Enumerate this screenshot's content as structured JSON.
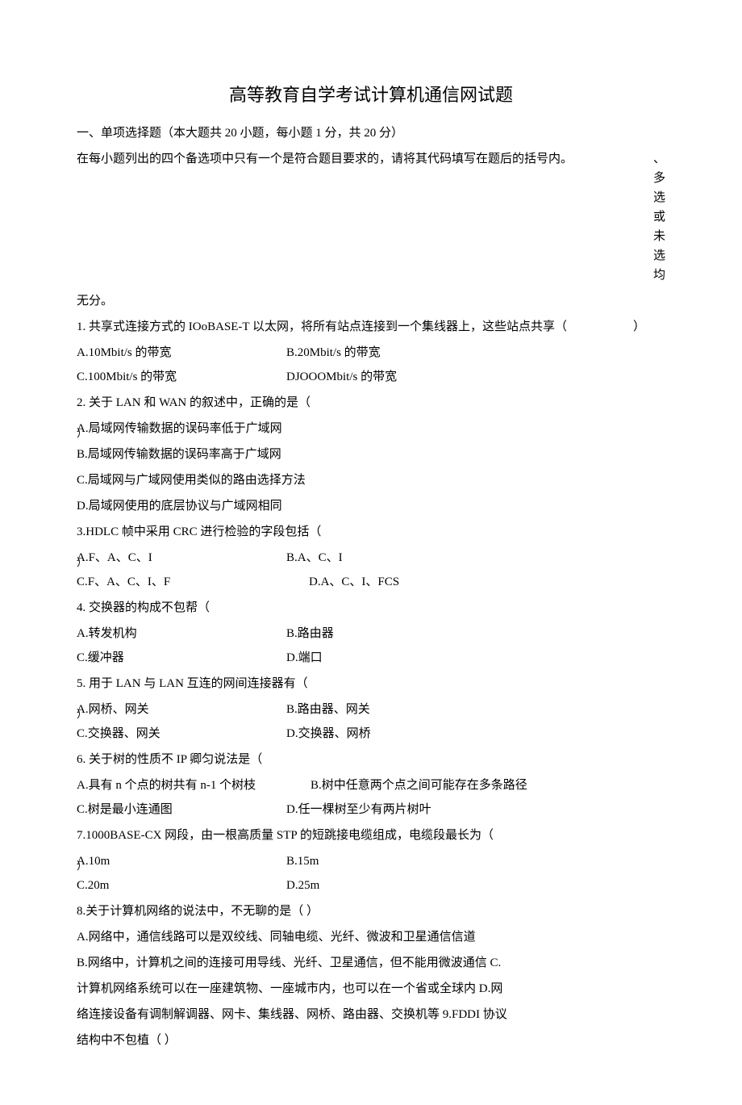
{
  "title": "高等教育自学考试计算机通信网试题",
  "section1_header": "一、单项选择题（本大题共 20 小题，每小题 1 分，共 20 分）",
  "instructions_left": "在每小题列出的四个备选项中只有一个是符合题目要求的，请将其代码填写在题后的括号内。",
  "instructions_right": "、多选或未选均",
  "instructions_cont": "无分。",
  "q1": {
    "stem": "1. 共享式连接方式的 IOoBASE-T 以太网，将所有站点连接到一个集线器上，这些站点共享（",
    "paren": "）",
    "a": "A.10Mbit/s 的带宽",
    "b": "B.20Mbit/s 的带宽",
    "c": "C.100Mbit/s 的带宽",
    "d": "DJOOOMbit/s 的带宽"
  },
  "q2": {
    "stem": "2. 关于 LAN 和 WAN 的叙述中，正确的是（",
    "a": "A.局域网传输数据的误码率低于广域网",
    "a_sub": "）",
    "b": "B.局域网传输数据的误码率高于广域网",
    "c": "C.局域网与广域网使用类似的路由选择方法",
    "d": "D.局域网使用的底层协议与广域网相同"
  },
  "q3": {
    "stem": "3.HDLC 帧中采用 CRC 进行检验的字段包括（",
    "a": "A.F、A、C、I",
    "a_sub": "）",
    "b": "B.A、C、I",
    "c": "C.F、A、C、I、F",
    "d": "D.A、C、I、FCS"
  },
  "q4": {
    "stem": "4. 交换器的构成不包帮（",
    "a": "A.转发机构",
    "b": "B.路由器",
    "c": "C.缓冲器",
    "d": "D.端口"
  },
  "q5": {
    "stem": "5. 用于 LAN 与 LAN 互连的网间连接器有（",
    "a": "A.网桥、网关",
    "a_sub": "）",
    "b": "B.路由器、网关",
    "c": "C.交换器、网关",
    "d": "D.交换器、网桥"
  },
  "q6": {
    "stem": "6. 关于树的性质不 IP 卿匀说法是（",
    "a": "A.具有 n 个点的树共有 n-1 个树枝",
    "b": "B.树中任意两个点之间可能存在多条路径",
    "c": "C.树是最小连通图",
    "d": "D.任一棵树至少有两片树叶"
  },
  "q7": {
    "stem": "7.1000BASE-CX 网段，由一根高质量 STP 的短跳接电缆组成，电缆段最长为（",
    "a": "A.10m",
    "a_sub": "）",
    "b": "B.15m",
    "c": "C.20m",
    "d": "D.25m"
  },
  "q8_9": {
    "line1": "8.关于计算机网络的说法中，不无聊的是（               ）",
    "line2": "A.网络中，通信线路可以是双绞线、同轴电缆、光纤、微波和卫星通信信道",
    "line3": "B.网络中，计算机之间的连接可用导线、光纤、卫星通信，但不能用微波通信 C.",
    "line4": "计算机网络系统可以在一座建筑物、一座城市内，也可以在一个省或全球内 D.网",
    "line5": "络连接设备有调制解调器、网卡、集线器、网桥、路由器、交换机等 9.FDDI 协议",
    "line6": "结构中不包植（                           ）"
  }
}
